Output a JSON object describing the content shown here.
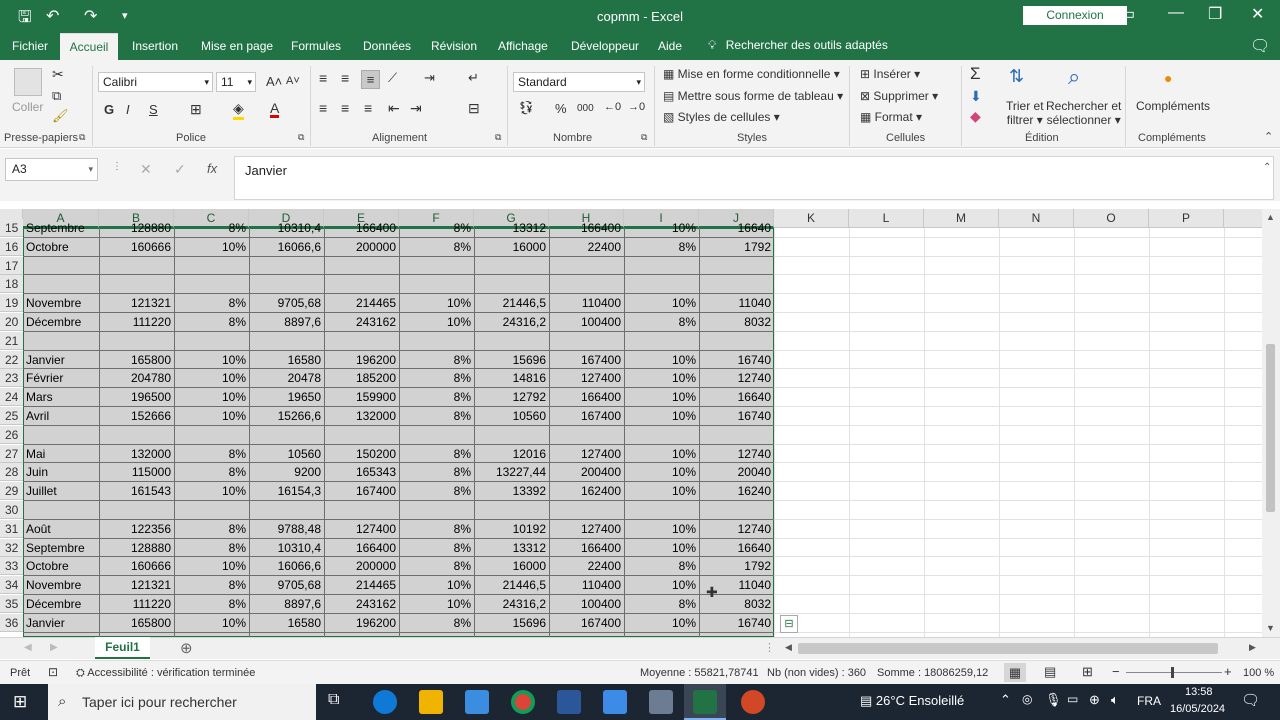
{
  "window": {
    "title": "copmm - Excel",
    "connexion": "Connexion"
  },
  "menu": {
    "items": [
      "Fichier",
      "Accueil",
      "Insertion",
      "Mise en page",
      "Formules",
      "Données",
      "Révision",
      "Affichage",
      "Développeur",
      "Aide"
    ],
    "search": "Rechercher des outils adaptés"
  },
  "ribbon": {
    "clipboard": {
      "paste": "Coller",
      "label": "Presse-papiers"
    },
    "font": {
      "name": "Calibri",
      "size": "11",
      "label": "Police",
      "bold": "G",
      "italic": "I",
      "underline": "S"
    },
    "alignment": {
      "label": "Alignement"
    },
    "number": {
      "format": "Standard",
      "percent": "%",
      "thousands": "000",
      "label": "Nombre"
    },
    "styles": {
      "conditional": "Mise en forme conditionnelle",
      "table": "Mettre sous forme de tableau",
      "cell_styles": "Styles de cellules",
      "label": "Styles"
    },
    "cells": {
      "insert": "Insérer",
      "delete": "Supprimer",
      "format": "Format",
      "label": "Cellules"
    },
    "editing": {
      "sort1": "Trier et",
      "sort2": "filtrer",
      "find1": "Rechercher et",
      "find2": "sélectionner",
      "label": "Édition"
    },
    "addins": {
      "label": "Compléments",
      "button": "Compléments"
    }
  },
  "formula_bar": {
    "name_box": "A3",
    "fx": "fx",
    "content": "Janvier"
  },
  "columns": [
    "A",
    "B",
    "C",
    "D",
    "E",
    "F",
    "G",
    "H",
    "I",
    "J",
    "K",
    "L",
    "M",
    "N",
    "O",
    "P"
  ],
  "rows": [
    {
      "n": "15",
      "c": [
        "Septembre",
        "128880",
        "8%",
        "10310,4",
        "166400",
        "8%",
        "13312",
        "166400",
        "10%",
        "16640"
      ]
    },
    {
      "n": "16",
      "c": [
        "Octobre",
        "160666",
        "10%",
        "16066,6",
        "200000",
        "8%",
        "16000",
        "22400",
        "8%",
        "1792"
      ]
    },
    {
      "n": "17",
      "c": [
        "",
        "",
        "",
        "",
        "",
        "",
        "",
        "",
        "",
        ""
      ]
    },
    {
      "n": "18",
      "c": [
        "",
        "",
        "",
        "",
        "",
        "",
        "",
        "",
        "",
        ""
      ]
    },
    {
      "n": "19",
      "c": [
        "Novembre",
        "121321",
        "8%",
        "9705,68",
        "214465",
        "10%",
        "21446,5",
        "110400",
        "10%",
        "11040"
      ]
    },
    {
      "n": "20",
      "c": [
        "Décembre",
        "111220",
        "8%",
        "8897,6",
        "243162",
        "10%",
        "24316,2",
        "100400",
        "8%",
        "8032"
      ]
    },
    {
      "n": "21",
      "c": [
        "",
        "",
        "",
        "",
        "",
        "",
        "",
        "",
        "",
        ""
      ]
    },
    {
      "n": "22",
      "c": [
        "Janvier",
        "165800",
        "10%",
        "16580",
        "196200",
        "8%",
        "15696",
        "167400",
        "10%",
        "16740"
      ]
    },
    {
      "n": "23",
      "c": [
        "Février",
        "204780",
        "10%",
        "20478",
        "185200",
        "8%",
        "14816",
        "127400",
        "10%",
        "12740"
      ]
    },
    {
      "n": "24",
      "c": [
        "Mars",
        "196500",
        "10%",
        "19650",
        "159900",
        "8%",
        "12792",
        "166400",
        "10%",
        "16640"
      ]
    },
    {
      "n": "25",
      "c": [
        "Avril",
        "152666",
        "10%",
        "15266,6",
        "132000",
        "8%",
        "10560",
        "167400",
        "10%",
        "16740"
      ]
    },
    {
      "n": "26",
      "c": [
        "",
        "",
        "",
        "",
        "",
        "",
        "",
        "",
        "",
        ""
      ]
    },
    {
      "n": "27",
      "c": [
        "Mai",
        "132000",
        "8%",
        "10560",
        "150200",
        "8%",
        "12016",
        "127400",
        "10%",
        "12740"
      ]
    },
    {
      "n": "28",
      "c": [
        "Juin",
        "115000",
        "8%",
        "9200",
        "165343",
        "8%",
        "13227,44",
        "200400",
        "10%",
        "20040"
      ]
    },
    {
      "n": "29",
      "c": [
        "Juillet",
        "161543",
        "10%",
        "16154,3",
        "167400",
        "8%",
        "13392",
        "162400",
        "10%",
        "16240"
      ]
    },
    {
      "n": "30",
      "c": [
        "",
        "",
        "",
        "",
        "",
        "",
        "",
        "",
        "",
        ""
      ]
    },
    {
      "n": "31",
      "c": [
        "Août",
        "122356",
        "8%",
        "9788,48",
        "127400",
        "8%",
        "10192",
        "127400",
        "10%",
        "12740"
      ]
    },
    {
      "n": "32",
      "c": [
        "Septembre",
        "128880",
        "8%",
        "10310,4",
        "166400",
        "8%",
        "13312",
        "166400",
        "10%",
        "16640"
      ]
    },
    {
      "n": "33",
      "c": [
        "Octobre",
        "160666",
        "10%",
        "16066,6",
        "200000",
        "8%",
        "16000",
        "22400",
        "8%",
        "1792"
      ]
    },
    {
      "n": "34",
      "c": [
        "Novembre",
        "121321",
        "8%",
        "9705,68",
        "214465",
        "10%",
        "21446,5",
        "110400",
        "10%",
        "11040"
      ]
    },
    {
      "n": "35",
      "c": [
        "Décembre",
        "111220",
        "8%",
        "8897,6",
        "243162",
        "10%",
        "24316,2",
        "100400",
        "8%",
        "8032"
      ]
    },
    {
      "n": "36",
      "c": [
        "Janvier",
        "165800",
        "10%",
        "16580",
        "196200",
        "8%",
        "15696",
        "167400",
        "10%",
        "16740"
      ]
    }
  ],
  "sheet": {
    "tab": "Feuil1"
  },
  "status": {
    "ready": "Prêt",
    "accessibility": "Accessibilité : vérification terminée",
    "average": "Moyenne : 55821,78741",
    "count": "Nb (non vides) : 360",
    "sum": "Somme : 18086259,12",
    "zoom": "100 %"
  },
  "taskbar": {
    "search": "Taper ici pour rechercher",
    "weather": "26°C  Ensoleillé",
    "lang": "FRA",
    "time": "13:58",
    "date": "16/05/2024"
  },
  "colors": {
    "accent": "#217346",
    "selection": "#d2d2d2"
  }
}
